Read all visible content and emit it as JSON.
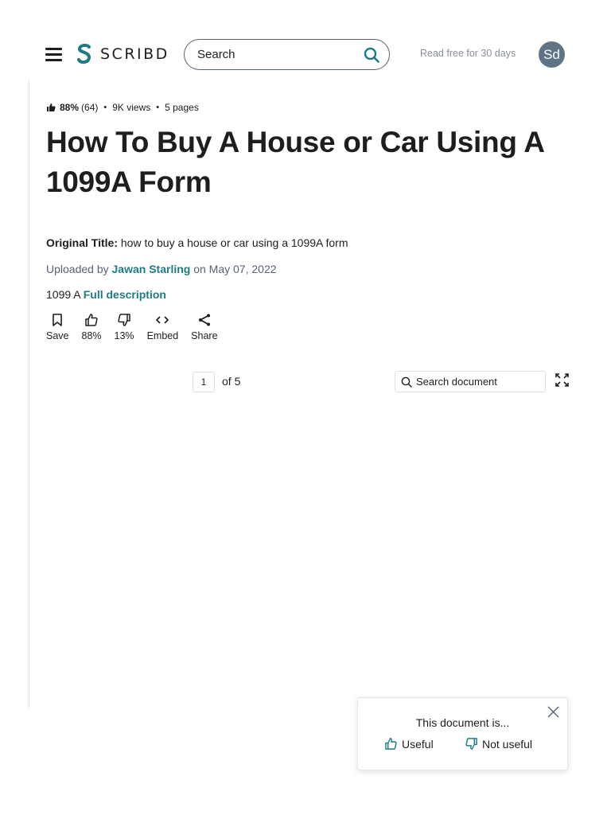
{
  "header": {
    "logo_text": "SCRIBD",
    "search_placeholder": "Search",
    "read_free": "Read free for 30 days",
    "avatar_initials": "Sd"
  },
  "document": {
    "rating": "88%",
    "rating_count": "(64)",
    "views": "9K views",
    "pages": "5 pages",
    "title": "How To Buy A House or Car Using A 1099A Form",
    "original_title_label": "Original Title:",
    "original_title": "how to buy a house or car using a 1099A form",
    "uploaded_by_label": "Uploaded by",
    "uploader": "Jawan Starling",
    "uploaded_on": "on May 07, 2022",
    "description": "1099 A",
    "full_description_link": "Full description"
  },
  "actions": [
    {
      "label": "Save",
      "icon": "bookmark-icon"
    },
    {
      "label": "88%",
      "icon": "thumbs-up-icon"
    },
    {
      "label": "13%",
      "icon": "thumbs-down-icon"
    },
    {
      "label": "Embed",
      "icon": "code-icon"
    },
    {
      "label": "Share",
      "icon": "share-icon"
    }
  ],
  "viewer": {
    "current_page": "1",
    "page_total": "of 5",
    "search_placeholder": "Search document"
  },
  "feedback": {
    "prompt": "This document is...",
    "useful": "Useful",
    "not_useful": "Not useful"
  },
  "colors": {
    "brand": "#1e7b85",
    "avatar": "#5f7587",
    "text": "#1e1e1e"
  }
}
